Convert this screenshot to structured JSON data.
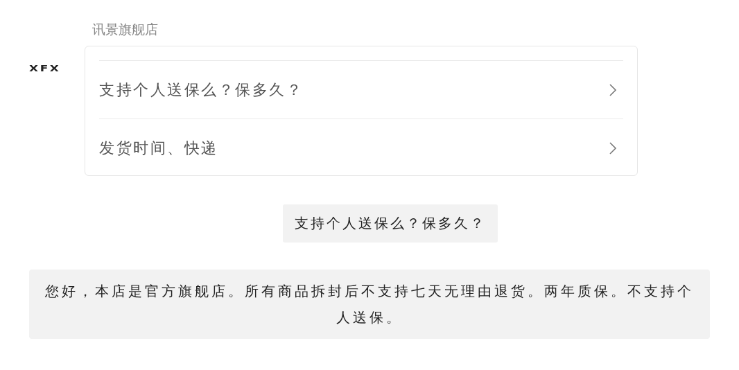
{
  "shop": {
    "name": "讯景旗舰店",
    "logo": "XFX"
  },
  "quick_questions": [
    {
      "label": "支持个人送保么？保多久？"
    },
    {
      "label": "发货时间、快递"
    }
  ],
  "messages": [
    {
      "kind": "sent",
      "text": "支持个人送保么？保多久？"
    },
    {
      "kind": "received",
      "text": "您好，本店是官方旗舰店。所有商品拆封后不支持七天无理由退货。两年质保。不支持个人送保。"
    }
  ]
}
